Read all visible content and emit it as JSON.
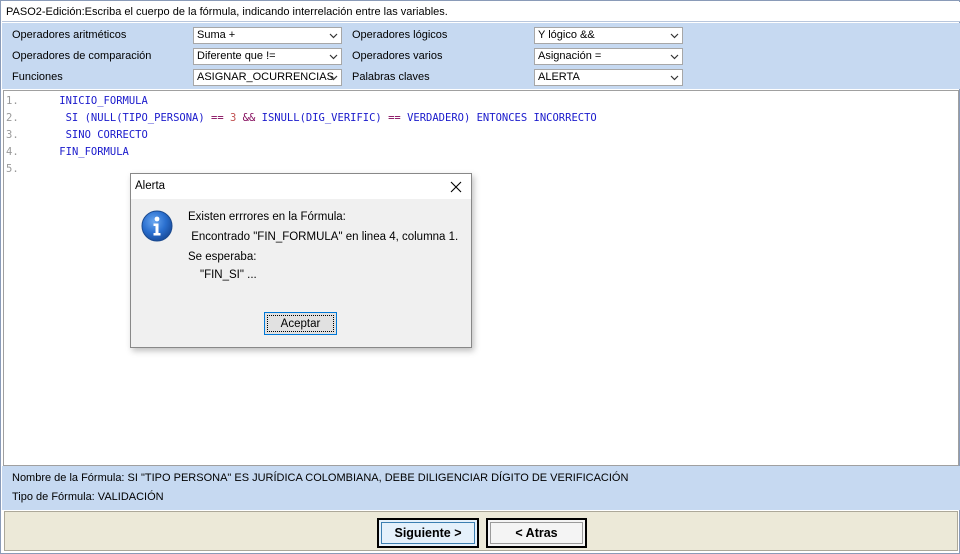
{
  "window": {
    "title": "PASO2-Edición:Escriba el cuerpo de la fórmula, indicando interrelación entre las variables."
  },
  "operators": {
    "arithmetic": {
      "label": "Operadores aritméticos",
      "value": "Suma +"
    },
    "comparison": {
      "label": "Operadores de comparación",
      "value": "Diferente que !="
    },
    "functions": {
      "label": "Funciones",
      "value": "ASIGNAR_OCURRENCIAS"
    },
    "logical": {
      "label": "Operadores lógicos",
      "value": "Y lógico &&"
    },
    "misc": {
      "label": "Operadores varios",
      "value": "Asignación ="
    },
    "keywords": {
      "label": "Palabras claves",
      "value": "ALERTA"
    }
  },
  "editor": {
    "lines": [
      {
        "num": "1.",
        "indent": "    ",
        "parts": [
          {
            "t": "INICIO_FORMULA",
            "c": "kw"
          }
        ]
      },
      {
        "num": "2.",
        "indent": "     ",
        "parts": [
          {
            "t": "SI ",
            "c": "kw"
          },
          {
            "t": "(",
            "c": "tx"
          },
          {
            "t": "NULL",
            "c": "kw"
          },
          {
            "t": "(TIPO_PERSONA) ",
            "c": "tx"
          },
          {
            "t": "==",
            "c": "op"
          },
          {
            "t": " ",
            "c": "tx"
          },
          {
            "t": "3",
            "c": "num"
          },
          {
            "t": " ",
            "c": "tx"
          },
          {
            "t": "&&",
            "c": "op"
          },
          {
            "t": " ISNULL(DIG_VERIFIC) ",
            "c": "tx"
          },
          {
            "t": "==",
            "c": "op"
          },
          {
            "t": " VERDADERO) ",
            "c": "tx"
          },
          {
            "t": "ENTONCES",
            "c": "kw"
          },
          {
            "t": " INCORRECTO",
            "c": "tx"
          }
        ]
      },
      {
        "num": "3.",
        "indent": "     ",
        "parts": [
          {
            "t": "SINO",
            "c": "kw"
          },
          {
            "t": " CORRECTO",
            "c": "tx"
          }
        ]
      },
      {
        "num": "4.",
        "indent": "    ",
        "parts": [
          {
            "t": "FIN_FORMULA",
            "c": "kw"
          }
        ]
      },
      {
        "num": "5.",
        "indent": "",
        "parts": []
      }
    ]
  },
  "info": {
    "formula_name": "Nombre de la Fórmula: SI \"TIPO PERSONA\" ES JURÍDICA COLOMBIANA, DEBE DILIGENCIAR DÍGITO DE VERIFICACIÓN",
    "formula_type": "Tipo de Fórmula: VALIDACIÓN"
  },
  "buttons": {
    "next": "Siguiente >",
    "back": "< Atras"
  },
  "dialog": {
    "title": "Alerta",
    "line1": "Existen errrores en la Fórmula:",
    "line2": " Encontrado \"FIN_FORMULA\" en linea 4, columna 1.",
    "line3": "Se esperaba:",
    "line4": "\"FIN_SI\" ...",
    "ok": "Aceptar"
  },
  "colors": {
    "panel": "#c6d9f1",
    "keyword": "#1a1acc",
    "operator": "#7f0055",
    "number": "#c05050",
    "line_number": "#999999"
  }
}
